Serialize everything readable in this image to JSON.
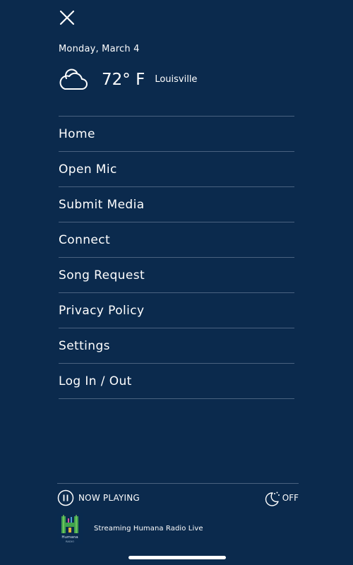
{
  "header": {
    "close_icon": "close-icon",
    "date": "Monday, March 4"
  },
  "weather": {
    "icon": "cloud-icon",
    "temperature": "72° F",
    "location": "Louisville"
  },
  "menu": {
    "items": [
      {
        "label": "Home"
      },
      {
        "label": "Open Mic"
      },
      {
        "label": "Submit Media"
      },
      {
        "label": "Connect"
      },
      {
        "label": "Song Request"
      },
      {
        "label": "Privacy Policy"
      },
      {
        "label": "Settings"
      },
      {
        "label": "Log In / Out"
      }
    ]
  },
  "player": {
    "status_icon": "pause-icon",
    "status_label": "NOW PLAYING",
    "sleep_timer_icon": "moon-icon",
    "sleep_timer_label": "OFF",
    "station_logo": {
      "name": "Humana",
      "subtitle": "RADIO"
    },
    "station_title": "Streaming Humana Radio Live"
  },
  "colors": {
    "background": "#0b2a4d",
    "divider": "#4a6280",
    "text": "#ffffff"
  }
}
